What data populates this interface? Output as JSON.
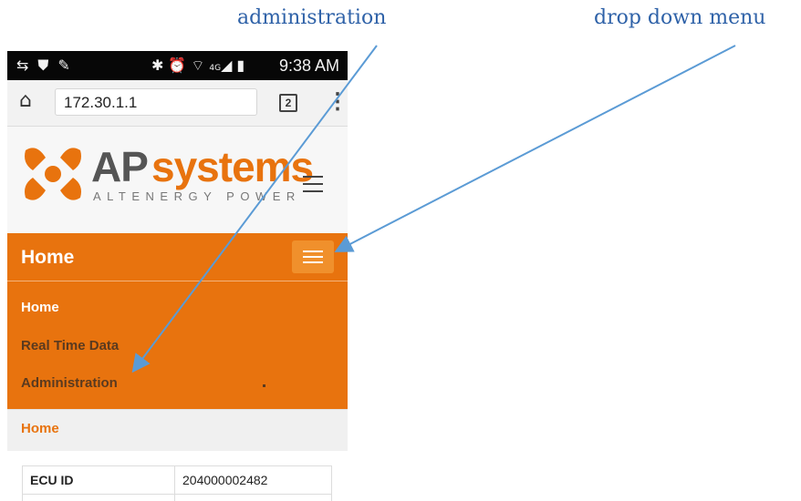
{
  "annotations": {
    "administration": "administration",
    "drop_down_menu": "drop down menu"
  },
  "status_bar": {
    "left_icons": [
      "sync-icon",
      "shield-icon",
      "edit-icon"
    ],
    "right_icons": [
      "bluetooth-icon",
      "alarm-icon",
      "wifi-icon",
      "signal-icon",
      "battery-icon"
    ],
    "network": "4G",
    "time": "9:38 AM"
  },
  "browser": {
    "url": "172.30.1.1",
    "tab_count": "2"
  },
  "logo": {
    "brand_ap": "AP",
    "brand_systems": "systems",
    "tagline": "ALTENERGY POWER"
  },
  "nav": {
    "heading": "Home",
    "menu_items": [
      "Home",
      "Real Time Data",
      "Administration"
    ]
  },
  "breadcrumb": "Home",
  "table": {
    "rows": [
      {
        "label": "ECU ID",
        "value": "204000002482"
      }
    ]
  },
  "colors": {
    "accent": "#e8730e",
    "annotation": "#2f62a8",
    "arrow": "#5b9bd5"
  }
}
